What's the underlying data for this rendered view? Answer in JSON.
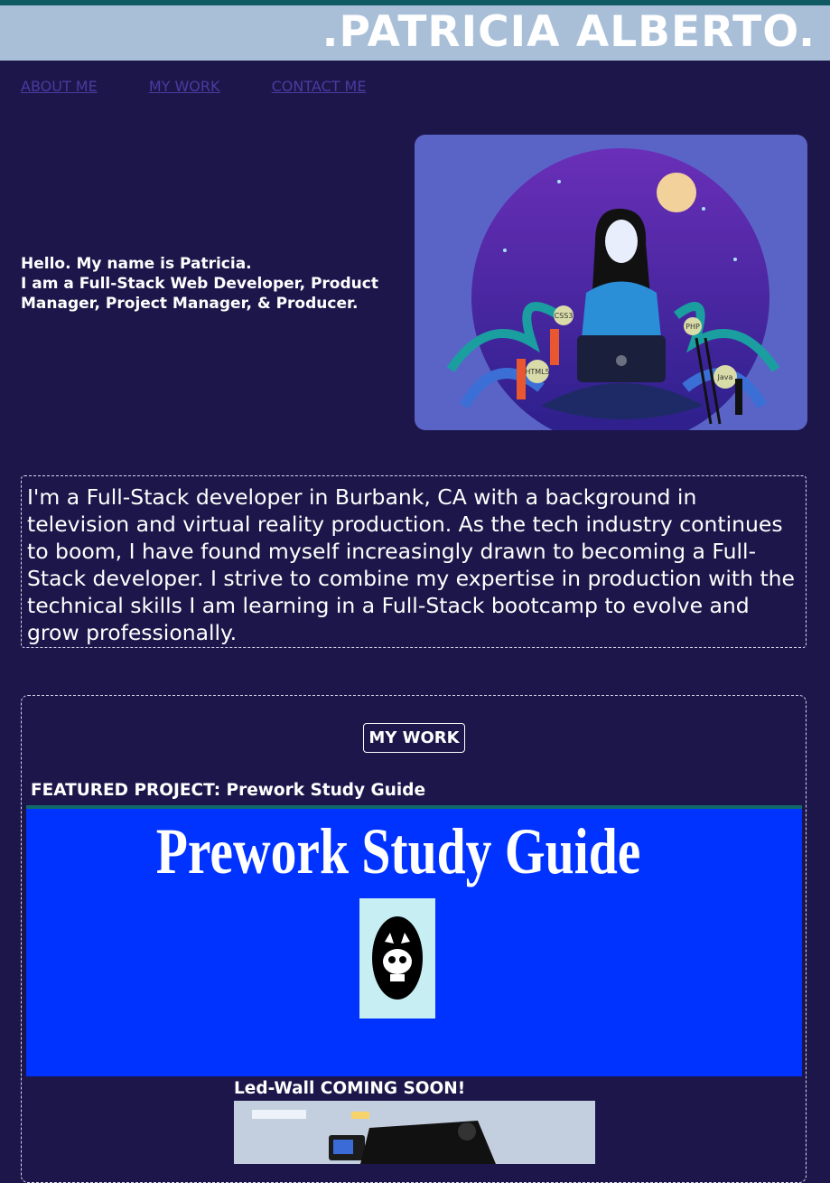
{
  "header": {
    "title": ".PATRICIA ALBERTO."
  },
  "nav": {
    "items": [
      "ABOUT ME",
      "MY WORK",
      "CONTACT ME"
    ]
  },
  "intro": {
    "line1": "Hello. My name is Patricia.",
    "line2": "I am a Full-Stack Web Developer, Product Manager, Project Manager, & Producer."
  },
  "hero": {
    "badges": [
      "CSS3",
      "PHP",
      "HTML5",
      "Java"
    ]
  },
  "about": {
    "text": "I'm a Full-Stack developer in Burbank, CA with a background in television and virtual reality production. As the tech industry continues to boom, I have found myself increasingly drawn to becoming a Full-Stack developer. I strive to combine my expertise in production with the technical skills I am learning in a Full-Stack bootcamp to evolve and grow professionally."
  },
  "work": {
    "heading": "MY WORK",
    "featured_label": "FEATURED PROJECT: Prework Study Guide",
    "featured_image_title": "Prework Study Guide",
    "coming_label": "Led-Wall COMING SOON!"
  },
  "colors": {
    "background": "#1d164a",
    "header_band": "#a9bfd8",
    "nav_link": "#4b3aa0",
    "featured_bg": "#0033ff"
  }
}
